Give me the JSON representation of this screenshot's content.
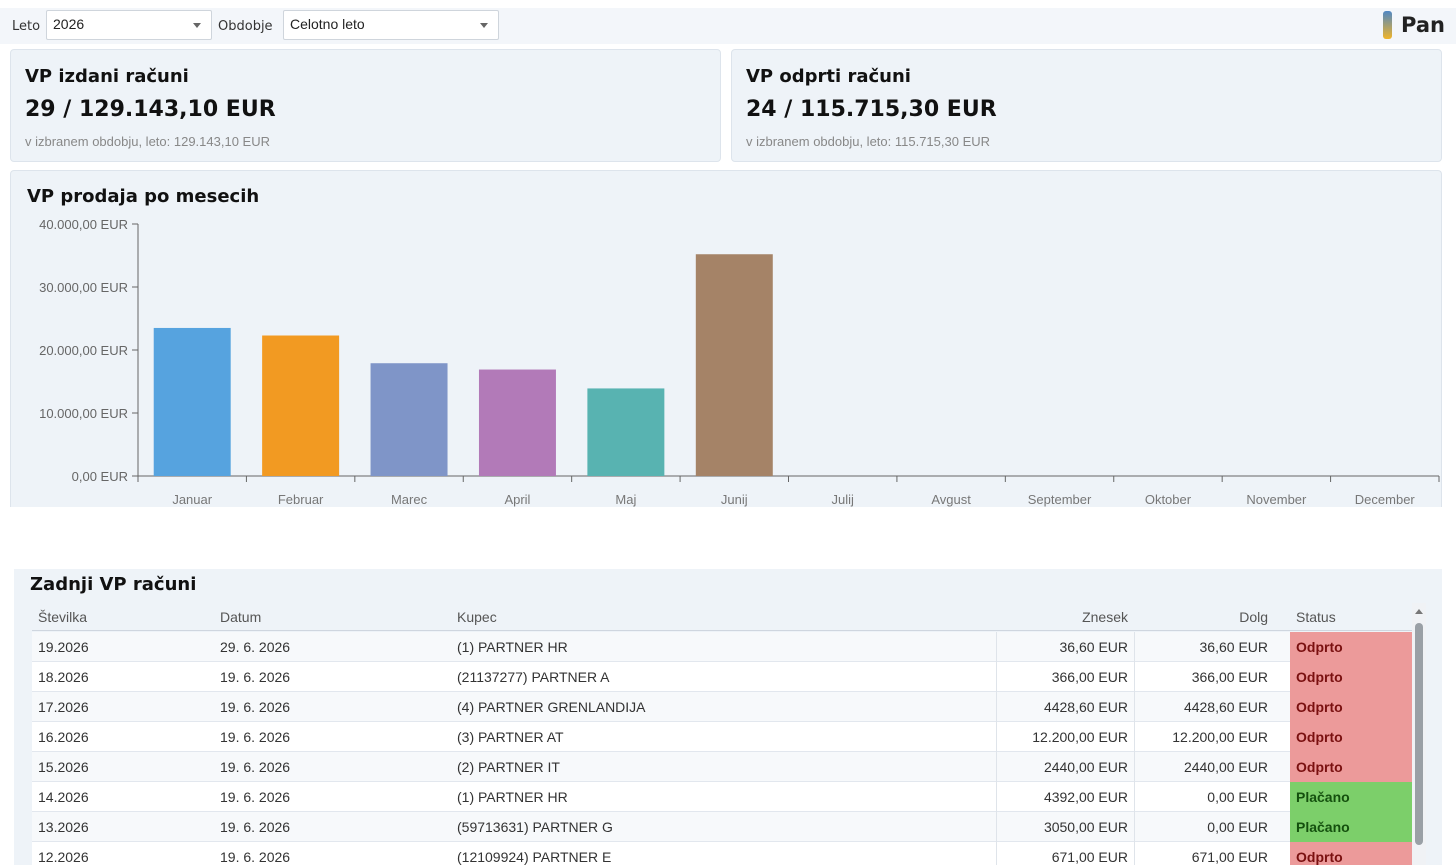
{
  "filters": {
    "year_label": "Leto",
    "year_value": "2026",
    "period_label": "Obdobje",
    "period_value": "Celotno leto"
  },
  "brand": {
    "text": "Pan"
  },
  "cards": [
    {
      "title": "VP izdani računi",
      "value": "29 / 129.143,10 EUR",
      "sub": "v izbranem obdobju, leto: 129.143,10 EUR"
    },
    {
      "title": "VP odprti računi",
      "value": "24 / 115.715,30 EUR",
      "sub": "v izbranem obdobju, leto: 115.715,30 EUR"
    }
  ],
  "chart_data": {
    "type": "bar",
    "title": "VP prodaja po mesecih",
    "categories": [
      "Januar",
      "Februar",
      "Marec",
      "April",
      "Maj",
      "Junij",
      "Julij",
      "Avgust",
      "September",
      "Oktober",
      "November",
      "December"
    ],
    "values": [
      23500,
      22300,
      17900,
      16900,
      13900,
      35200,
      0,
      0,
      0,
      0,
      0,
      0
    ],
    "colors": [
      "#56a3df",
      "#f29a22",
      "#7f95c8",
      "#b27ab8",
      "#58b3b1",
      "#a58367",
      "#999999",
      "#999999",
      "#999999",
      "#999999",
      "#999999",
      "#999999"
    ],
    "ylim": [
      0,
      40000
    ],
    "yticks": [
      0,
      10000,
      20000,
      30000,
      40000
    ],
    "ytick_labels": [
      "0,00 EUR",
      "10.000,00 EUR",
      "20.000,00 EUR",
      "30.000,00 EUR",
      "40.000,00 EUR"
    ],
    "grid": false,
    "legend": "none"
  },
  "table": {
    "title": "Zadnji VP računi",
    "columns": [
      "Številka",
      "Datum",
      "Kupec",
      "Znesek",
      "Dolg",
      "Status"
    ],
    "rows": [
      {
        "number": "19.2026",
        "date": "29. 6. 2026",
        "customer": "(1) PARTNER HR",
        "amount": "36,60 EUR",
        "debt": "36,60 EUR",
        "status": "Odprto"
      },
      {
        "number": "18.2026",
        "date": "19. 6. 2026",
        "customer": "(21137277) PARTNER A",
        "amount": "366,00 EUR",
        "debt": "366,00 EUR",
        "status": "Odprto"
      },
      {
        "number": "17.2026",
        "date": "19. 6. 2026",
        "customer": "(4) PARTNER GRENLANDIJA",
        "amount": "4428,60 EUR",
        "debt": "4428,60 EUR",
        "status": "Odprto"
      },
      {
        "number": "16.2026",
        "date": "19. 6. 2026",
        "customer": "(3) PARTNER AT",
        "amount": "12.200,00 EUR",
        "debt": "12.200,00 EUR",
        "status": "Odprto"
      },
      {
        "number": "15.2026",
        "date": "19. 6. 2026",
        "customer": "(2) PARTNER IT",
        "amount": "2440,00 EUR",
        "debt": "2440,00 EUR",
        "status": "Odprto"
      },
      {
        "number": "14.2026",
        "date": "19. 6. 2026",
        "customer": "(1) PARTNER HR",
        "amount": "4392,00 EUR",
        "debt": "0,00 EUR",
        "status": "Plačano"
      },
      {
        "number": "13.2026",
        "date": "19. 6. 2026",
        "customer": "(59713631) PARTNER G",
        "amount": "3050,00 EUR",
        "debt": "0,00 EUR",
        "status": "Plačano"
      },
      {
        "number": "12.2026",
        "date": "19. 6. 2026",
        "customer": "(12109924) PARTNER E",
        "amount": "671,00 EUR",
        "debt": "671,00 EUR",
        "status": "Odprto"
      }
    ],
    "status_colors": {
      "Odprto": "#ec9a9a",
      "Plačano": "#7ccf6a"
    },
    "status_text_colors": {
      "Odprto": "#7a1010",
      "Plačano": "#14500e"
    }
  }
}
